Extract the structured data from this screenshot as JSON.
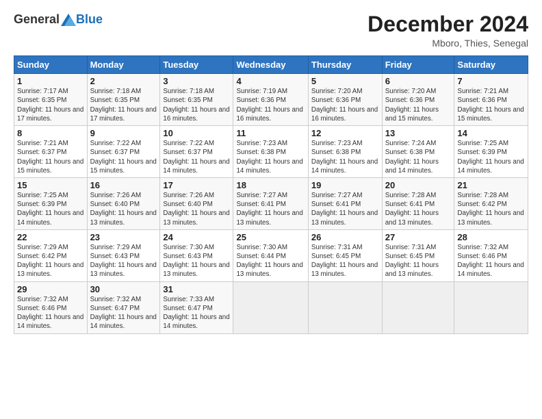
{
  "header": {
    "logo_general": "General",
    "logo_blue": "Blue",
    "month_title": "December 2024",
    "location": "Mboro, Thies, Senegal"
  },
  "calendar": {
    "days_of_week": [
      "Sunday",
      "Monday",
      "Tuesday",
      "Wednesday",
      "Thursday",
      "Friday",
      "Saturday"
    ],
    "weeks": [
      [
        {
          "day": "1",
          "sunrise": "Sunrise: 7:17 AM",
          "sunset": "Sunset: 6:35 PM",
          "daylight": "Daylight: 11 hours and 17 minutes."
        },
        {
          "day": "2",
          "sunrise": "Sunrise: 7:18 AM",
          "sunset": "Sunset: 6:35 PM",
          "daylight": "Daylight: 11 hours and 17 minutes."
        },
        {
          "day": "3",
          "sunrise": "Sunrise: 7:18 AM",
          "sunset": "Sunset: 6:35 PM",
          "daylight": "Daylight: 11 hours and 16 minutes."
        },
        {
          "day": "4",
          "sunrise": "Sunrise: 7:19 AM",
          "sunset": "Sunset: 6:36 PM",
          "daylight": "Daylight: 11 hours and 16 minutes."
        },
        {
          "day": "5",
          "sunrise": "Sunrise: 7:20 AM",
          "sunset": "Sunset: 6:36 PM",
          "daylight": "Daylight: 11 hours and 16 minutes."
        },
        {
          "day": "6",
          "sunrise": "Sunrise: 7:20 AM",
          "sunset": "Sunset: 6:36 PM",
          "daylight": "Daylight: 11 hours and 15 minutes."
        },
        {
          "day": "7",
          "sunrise": "Sunrise: 7:21 AM",
          "sunset": "Sunset: 6:36 PM",
          "daylight": "Daylight: 11 hours and 15 minutes."
        }
      ],
      [
        {
          "day": "8",
          "sunrise": "Sunrise: 7:21 AM",
          "sunset": "Sunset: 6:37 PM",
          "daylight": "Daylight: 11 hours and 15 minutes."
        },
        {
          "day": "9",
          "sunrise": "Sunrise: 7:22 AM",
          "sunset": "Sunset: 6:37 PM",
          "daylight": "Daylight: 11 hours and 15 minutes."
        },
        {
          "day": "10",
          "sunrise": "Sunrise: 7:22 AM",
          "sunset": "Sunset: 6:37 PM",
          "daylight": "Daylight: 11 hours and 14 minutes."
        },
        {
          "day": "11",
          "sunrise": "Sunrise: 7:23 AM",
          "sunset": "Sunset: 6:38 PM",
          "daylight": "Daylight: 11 hours and 14 minutes."
        },
        {
          "day": "12",
          "sunrise": "Sunrise: 7:23 AM",
          "sunset": "Sunset: 6:38 PM",
          "daylight": "Daylight: 11 hours and 14 minutes."
        },
        {
          "day": "13",
          "sunrise": "Sunrise: 7:24 AM",
          "sunset": "Sunset: 6:38 PM",
          "daylight": "Daylight: 11 hours and 14 minutes."
        },
        {
          "day": "14",
          "sunrise": "Sunrise: 7:25 AM",
          "sunset": "Sunset: 6:39 PM",
          "daylight": "Daylight: 11 hours and 14 minutes."
        }
      ],
      [
        {
          "day": "15",
          "sunrise": "Sunrise: 7:25 AM",
          "sunset": "Sunset: 6:39 PM",
          "daylight": "Daylight: 11 hours and 14 minutes."
        },
        {
          "day": "16",
          "sunrise": "Sunrise: 7:26 AM",
          "sunset": "Sunset: 6:40 PM",
          "daylight": "Daylight: 11 hours and 13 minutes."
        },
        {
          "day": "17",
          "sunrise": "Sunrise: 7:26 AM",
          "sunset": "Sunset: 6:40 PM",
          "daylight": "Daylight: 11 hours and 13 minutes."
        },
        {
          "day": "18",
          "sunrise": "Sunrise: 7:27 AM",
          "sunset": "Sunset: 6:41 PM",
          "daylight": "Daylight: 11 hours and 13 minutes."
        },
        {
          "day": "19",
          "sunrise": "Sunrise: 7:27 AM",
          "sunset": "Sunset: 6:41 PM",
          "daylight": "Daylight: 11 hours and 13 minutes."
        },
        {
          "day": "20",
          "sunrise": "Sunrise: 7:28 AM",
          "sunset": "Sunset: 6:41 PM",
          "daylight": "Daylight: 11 hours and 13 minutes."
        },
        {
          "day": "21",
          "sunrise": "Sunrise: 7:28 AM",
          "sunset": "Sunset: 6:42 PM",
          "daylight": "Daylight: 11 hours and 13 minutes."
        }
      ],
      [
        {
          "day": "22",
          "sunrise": "Sunrise: 7:29 AM",
          "sunset": "Sunset: 6:42 PM",
          "daylight": "Daylight: 11 hours and 13 minutes."
        },
        {
          "day": "23",
          "sunrise": "Sunrise: 7:29 AM",
          "sunset": "Sunset: 6:43 PM",
          "daylight": "Daylight: 11 hours and 13 minutes."
        },
        {
          "day": "24",
          "sunrise": "Sunrise: 7:30 AM",
          "sunset": "Sunset: 6:43 PM",
          "daylight": "Daylight: 11 hours and 13 minutes."
        },
        {
          "day": "25",
          "sunrise": "Sunrise: 7:30 AM",
          "sunset": "Sunset: 6:44 PM",
          "daylight": "Daylight: 11 hours and 13 minutes."
        },
        {
          "day": "26",
          "sunrise": "Sunrise: 7:31 AM",
          "sunset": "Sunset: 6:45 PM",
          "daylight": "Daylight: 11 hours and 13 minutes."
        },
        {
          "day": "27",
          "sunrise": "Sunrise: 7:31 AM",
          "sunset": "Sunset: 6:45 PM",
          "daylight": "Daylight: 11 hours and 13 minutes."
        },
        {
          "day": "28",
          "sunrise": "Sunrise: 7:32 AM",
          "sunset": "Sunset: 6:46 PM",
          "daylight": "Daylight: 11 hours and 14 minutes."
        }
      ],
      [
        {
          "day": "29",
          "sunrise": "Sunrise: 7:32 AM",
          "sunset": "Sunset: 6:46 PM",
          "daylight": "Daylight: 11 hours and 14 minutes."
        },
        {
          "day": "30",
          "sunrise": "Sunrise: 7:32 AM",
          "sunset": "Sunset: 6:47 PM",
          "daylight": "Daylight: 11 hours and 14 minutes."
        },
        {
          "day": "31",
          "sunrise": "Sunrise: 7:33 AM",
          "sunset": "Sunset: 6:47 PM",
          "daylight": "Daylight: 11 hours and 14 minutes."
        },
        null,
        null,
        null,
        null
      ]
    ]
  }
}
